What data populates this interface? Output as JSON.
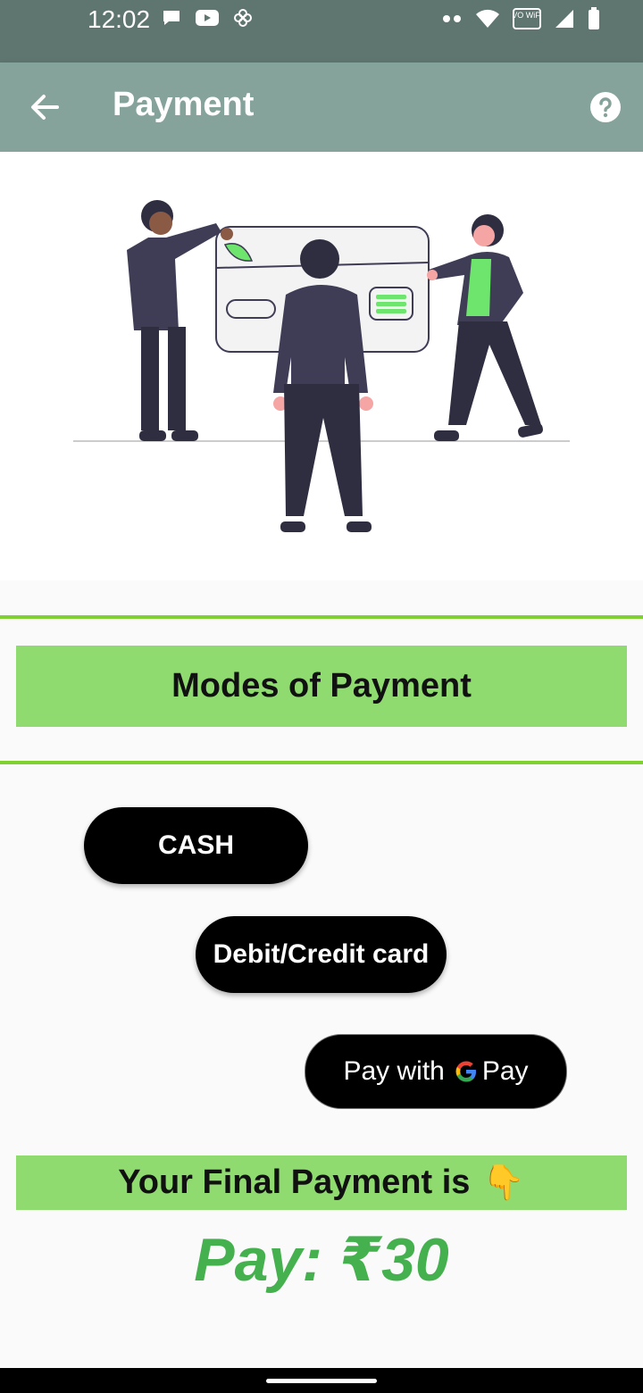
{
  "status": {
    "time": "12:02",
    "left_icons": [
      "chat-bubble-icon",
      "youtube-icon",
      "pinwheel-icon"
    ],
    "right_icons": [
      "more-dots-icon",
      "wifi-icon",
      "vowifi-icon",
      "signal-icon",
      "battery-icon"
    ],
    "vowifi_label": "VO WiFi"
  },
  "appbar": {
    "title": "Payment",
    "back_icon": "arrow-left-icon",
    "help_icon": "help-circle-icon"
  },
  "illustration": {
    "name": "people-with-credit-card"
  },
  "modes": {
    "header": "Modes of Payment",
    "cash_label": "CASH",
    "card_label": "Debit/Credit card",
    "gpay_prefix": "Pay with",
    "gpay_brand": "Pay"
  },
  "final": {
    "banner": "Your Final Payment is",
    "emoji": "👇",
    "amount": "Pay: ₹30"
  },
  "colors": {
    "statusbar": "#5f7670",
    "appbar": "#86a39b",
    "green_band": "#8fdb6f",
    "green_rule": "#7ed12e",
    "amount_green": "#45b04e",
    "button": "#000000"
  }
}
